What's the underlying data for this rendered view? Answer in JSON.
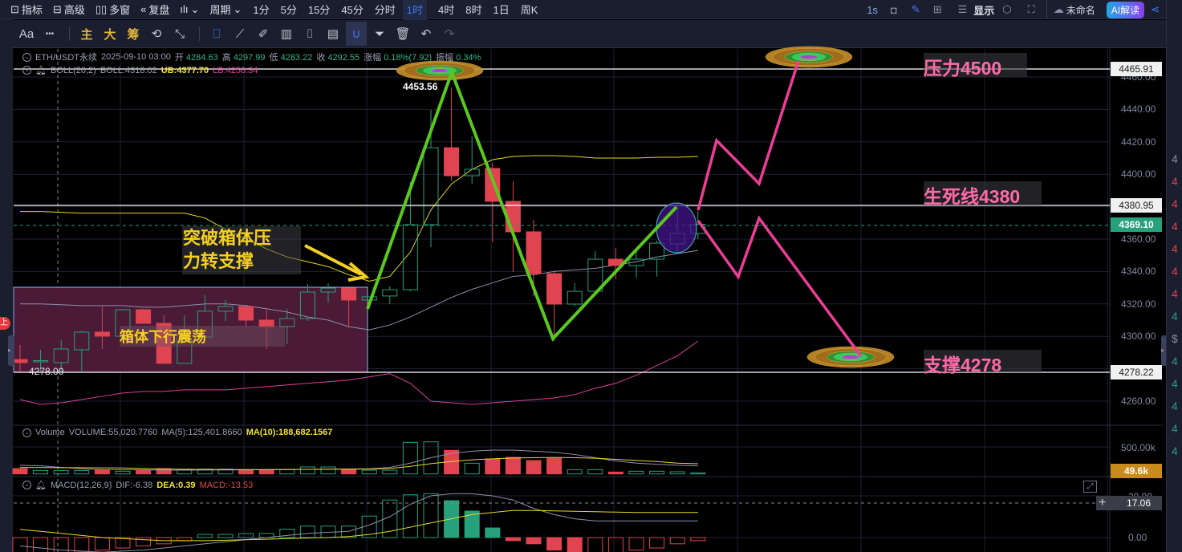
{
  "topbar": {
    "items": [
      {
        "icon": "chart-line-icon",
        "label": "指标"
      },
      {
        "icon": "template-icon",
        "label": "高级"
      },
      {
        "icon": "multi-window-icon",
        "label": "多窗"
      },
      {
        "icon": "replay-icon",
        "label": "复盘"
      }
    ],
    "chart_type_icon": "candlestick-icon",
    "period_label": "周期",
    "periods": [
      "1分",
      "5分",
      "15分",
      "45分",
      "分时",
      "1时",
      "4时",
      "8时",
      "1日",
      "周K"
    ],
    "active_period": "1时",
    "refresh": "1s",
    "display": "显示",
    "layout_name": "未命名",
    "ai_button": "AI解读"
  },
  "toolbar2": {
    "font": "Aa",
    "more": "•••",
    "main": "主",
    "big": "大",
    "chip": "筹"
  },
  "legend": {
    "symbol": "ETH/USDT永续",
    "time": "2025-09-10 03:00",
    "open_label": "开",
    "open": "4284.63",
    "high_label": "高",
    "high": "4297.99",
    "low_label": "低",
    "low": "4283.22",
    "close_label": "收",
    "close": "4292.55",
    "change_label": "涨幅",
    "change": "0.18%(7.92)",
    "amp_label": "振幅",
    "amp": "0.34%",
    "boll": "BOLL(20,2)",
    "boll_mid": "BOLL:4318.02",
    "boll_ub": "UB:4377.70",
    "boll_lb": "LB:4258.34"
  },
  "volume_legend": {
    "name": "Volume",
    "vol": "VOLUME:55,020.7760",
    "ma5": "MA(5):125,401.8660",
    "ma10": "MA(10):188,682.1567"
  },
  "macd_legend": {
    "name": "MACD(12,26,9)",
    "dif": "DIF:-6.38",
    "dea": "DEA:0.39",
    "macd": "MACD:-13.53"
  },
  "price_axis": [
    "4460.00",
    "4440.00",
    "4420.00",
    "4400.00",
    "4360.00",
    "4340.00",
    "4320.00",
    "4300.00",
    "4260.00"
  ],
  "volume_axis": "500.00k",
  "volume_tag": "49.6k",
  "macd_axis": [
    "20.00",
    "0.00"
  ],
  "macd_tag": "17.06",
  "tags": {
    "resistance": "4465.91",
    "lifeline": "4380.95",
    "current": "4369.10",
    "support": "4278.22"
  },
  "annotations": {
    "resistance": "压力4500",
    "lifeline": "生死线4380",
    "support": "支撑4278",
    "breakout_line1": "突破箱体压",
    "breakout_line2": "力转支撑",
    "box": "箱体下行震荡",
    "high_label": "4453.56",
    "box_low": "4278.00",
    "side_badge": "上"
  },
  "sidebar_fragments": [
    "4",
    "4",
    "4",
    "4",
    "4",
    "4",
    "4",
    "4",
    "$",
    "4",
    "4",
    "4",
    "4",
    "4"
  ],
  "colors": {
    "up": "#26a17b",
    "down": "#e04450",
    "accent": "#3d7cff",
    "annot_pink": "#ff6aa8",
    "annot_yellow": "#f5d020",
    "zigzag": "#5ac81e",
    "projection": "#ee3d96"
  },
  "chart_data": {
    "type": "candlestick",
    "candles": [
      [
        4285.7,
        4294.7,
        4278.3,
        4283.8
      ],
      [
        4284.5,
        4291.7,
        4278.3,
        4285
      ],
      [
        4283.8,
        4297.6,
        4278.3,
        4292.2
      ],
      [
        4291.7,
        4303.6,
        4278.8,
        4302.6
      ],
      [
        4302.6,
        4318.4,
        4292.2,
        4300.1
      ],
      [
        4300.1,
        4317,
        4300.1,
        4316.4
      ],
      [
        4316.4,
        4317,
        4308,
        4308
      ],
      [
        4308,
        4313,
        4283.3,
        4283.3
      ],
      [
        4283.3,
        4313,
        4283.3,
        4298.6
      ],
      [
        4299.6,
        4325.4,
        4299.6,
        4315.5
      ],
      [
        4315.5,
        4322.4,
        4309.5,
        4318.4
      ],
      [
        4318.4,
        4318.4,
        4306,
        4310
      ],
      [
        4310,
        4316.4,
        4292.2,
        4306
      ],
      [
        4306,
        4317,
        4295.2,
        4311
      ],
      [
        4311,
        4332.3,
        4309.5,
        4327.3
      ],
      [
        4327.3,
        4332.8,
        4321,
        4329.8
      ],
      [
        4329.8,
        4329.8,
        4305.6,
        4322.4
      ],
      [
        4322.4,
        4324.4,
        4322.4,
        4324.4
      ],
      [
        4324.9,
        4330.8,
        4319.9,
        4328.8
      ],
      [
        4328.8,
        4395.2,
        4327.8,
        4368.9
      ],
      [
        4368.9,
        4439.7,
        4355,
        4416.4
      ],
      [
        4416.4,
        4453.56,
        4396,
        4399.1
      ],
      [
        4399.1,
        4423.4,
        4394.2,
        4403.1
      ],
      [
        4403.6,
        4407,
        4358,
        4383.3
      ],
      [
        4383.3,
        4395.7,
        4339.7,
        4364.5
      ],
      [
        4364.5,
        4371.9,
        4324.9,
        4338.7
      ],
      [
        4338.7,
        4340.7,
        4297.1,
        4319.9
      ],
      [
        4319.9,
        4332.8,
        4318.4,
        4327.8
      ],
      [
        4327.8,
        4352.6,
        4327.8,
        4347.6
      ],
      [
        4347.6,
        4354.6,
        4335.3,
        4343.7
      ],
      [
        4343.7,
        4352.6,
        4336.3,
        4347.6
      ],
      [
        4347.6,
        4359,
        4336.8,
        4357.5
      ],
      [
        4357,
        4382.3,
        4352.1,
        4363.5
      ],
      [
        4363.5,
        4377.3,
        4360,
        4369.1
      ]
    ],
    "boll_upper": [
      4377,
      4377,
      4376.5,
      4376,
      4376,
      4376,
      4376,
      4376,
      4376,
      4373,
      4366,
      4360,
      4354,
      4349,
      4346,
      4343,
      4338,
      4334,
      4337,
      4352,
      4378,
      4394,
      4403,
      4409,
      4411,
      4411.5,
      4411.5,
      4411,
      4410,
      4410,
      4410,
      4410.5,
      4410.5,
      4411
    ],
    "boll_mid": [
      4320,
      4320,
      4319.5,
      4319,
      4319,
      4319,
      4318,
      4318,
      4319,
      4320,
      4320,
      4319,
      4317,
      4315,
      4312,
      4310,
      4306,
      4304,
      4307,
      4312,
      4318,
      4324,
      4329,
      4333,
      4337,
      4338,
      4340,
      4341,
      4342,
      4344,
      4346,
      4349,
      4351,
      4353
    ],
    "boll_lower": [
      4261,
      4258,
      4259,
      4261,
      4263,
      4265,
      4266,
      4266,
      4267,
      4267,
      4267,
      4268,
      4269,
      4270,
      4271,
      4272,
      4273,
      4275,
      4277,
      4271,
      4260,
      4259,
      4258,
      4259,
      4260,
      4261,
      4262,
      4264,
      4268,
      4271,
      4276,
      4282,
      4288,
      4297
    ],
    "volume_k": [
      99,
      64,
      64,
      64,
      79,
      50,
      69,
      99,
      89,
      89,
      89,
      79,
      79,
      79,
      129,
      129,
      89,
      69,
      69,
      584,
      594,
      436,
      198,
      277,
      307,
      248,
      287,
      79,
      79,
      35,
      50,
      50,
      40,
      20
    ],
    "vol_ma5_k": [
      160,
      150,
      120,
      95,
      80,
      78,
      75,
      72,
      70,
      72,
      74,
      76,
      78,
      80,
      84,
      88,
      92,
      95,
      120,
      200,
      300,
      380,
      420,
      440,
      440,
      420,
      400,
      360,
      300,
      240,
      200,
      180,
      160,
      150
    ],
    "vol_ma10_k": [
      120,
      118,
      116,
      114,
      112,
      110,
      100,
      90,
      84,
      82,
      80,
      80,
      80,
      82,
      84,
      86,
      88,
      90,
      100,
      140,
      190,
      230,
      260,
      280,
      295,
      300,
      305,
      300,
      290,
      270,
      250,
      230,
      200,
      188
    ],
    "macd_hist": [
      -8,
      -8,
      -7.5,
      -7,
      -6,
      -5,
      -4,
      -3,
      -1.5,
      1.5,
      1.5,
      1.9,
      2,
      4,
      5.5,
      5.5,
      5.5,
      10.3,
      18,
      20.5,
      21,
      17.7,
      12.7,
      4.6,
      -1.5,
      -3,
      -6,
      -8,
      -8,
      -8,
      -6,
      -5,
      -3,
      -1.5
    ],
    "dif": [
      -4,
      -5,
      -6,
      -6.5,
      -7,
      -6.5,
      -6,
      -5,
      -4,
      -3,
      -2,
      -1,
      0,
      1,
      2,
      2.5,
      3,
      6,
      10,
      16,
      20,
      21,
      21,
      20,
      18,
      14,
      11,
      9,
      8,
      8,
      8,
      8,
      8,
      8
    ],
    "dea": [
      3.9,
      3,
      2,
      1,
      0,
      -0.5,
      -1,
      -1.5,
      -1.5,
      -1.5,
      -1.3,
      -1,
      -0.8,
      -0.5,
      -0.2,
      0,
      0.5,
      1.5,
      3,
      5,
      7,
      9,
      11,
      12,
      13,
      13,
      12.8,
      12.6,
      12.4,
      12.2,
      12,
      12,
      12,
      12
    ],
    "price_range": [
      4250,
      4470
    ],
    "title": "ETH/USDT永续 1时"
  }
}
